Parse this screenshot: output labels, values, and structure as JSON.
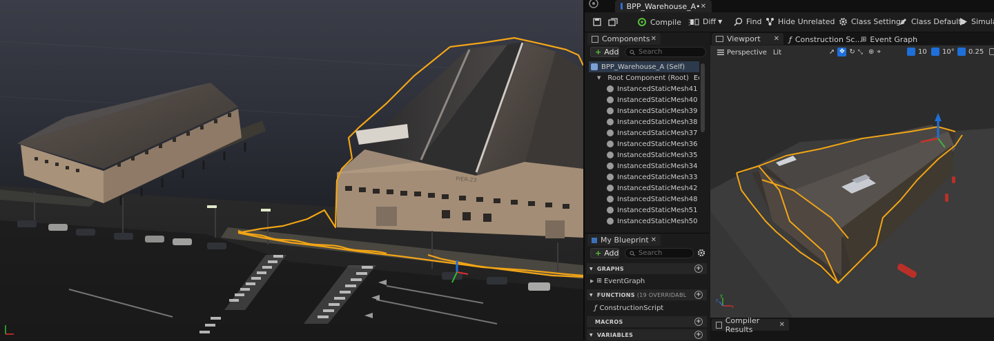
{
  "document_tab": {
    "title": "BPP_Warehouse_A•"
  },
  "toolbar": {
    "compile": "Compile",
    "diff": "Diff",
    "find": "Find",
    "hide_unrelated": "Hide Unrelated",
    "class_settings": "Class Settings",
    "class_defaults": "Class Defaults",
    "simulation": "Simulatio"
  },
  "components_panel": {
    "tab": "Components",
    "add": "Add",
    "search_placeholder": "Search",
    "self_item": "BPP_Warehouse_A (Self)",
    "root_item": "Root Component (Root)",
    "root_edit": "Edit in",
    "items": [
      "InstancedStaticMesh41",
      "InstancedStaticMesh40",
      "InstancedStaticMesh39",
      "InstancedStaticMesh38",
      "InstancedStaticMesh37",
      "InstancedStaticMesh36",
      "InstancedStaticMesh35",
      "InstancedStaticMesh34",
      "InstancedStaticMesh33",
      "InstancedStaticMesh42",
      "InstancedStaticMesh48",
      "InstancedStaticMesh51",
      "InstancedStaticMesh50"
    ]
  },
  "viewport_tabs": {
    "viewport": "Viewport",
    "construction": "Construction Sc...",
    "event_graph": "Event Graph"
  },
  "viewport_toolbar": {
    "perspective": "Perspective",
    "lit": "Lit",
    "grid_snap": "10",
    "rotation_snap": "10°",
    "scale_snap": "0.25"
  },
  "my_blueprint": {
    "tab": "My Blueprint",
    "add": "Add",
    "search_placeholder": "Search",
    "graphs_header": "GRAPHS",
    "event_graph_item": "EventGraph",
    "functions_header": "FUNCTIONS",
    "functions_note": "(19 OVERRIDABL",
    "construction_script_item": "ConstructionScript",
    "macros_header": "MACROS",
    "variables_header": "VARIABLES"
  },
  "compiler_results": {
    "tab": "Compiler Results"
  },
  "level_signage": {
    "pier_label": "PIER-23"
  },
  "colors": {
    "selection_outline": "#f2a516",
    "accent_blue": "#1e6fd9",
    "add_green": "#59c13b"
  }
}
